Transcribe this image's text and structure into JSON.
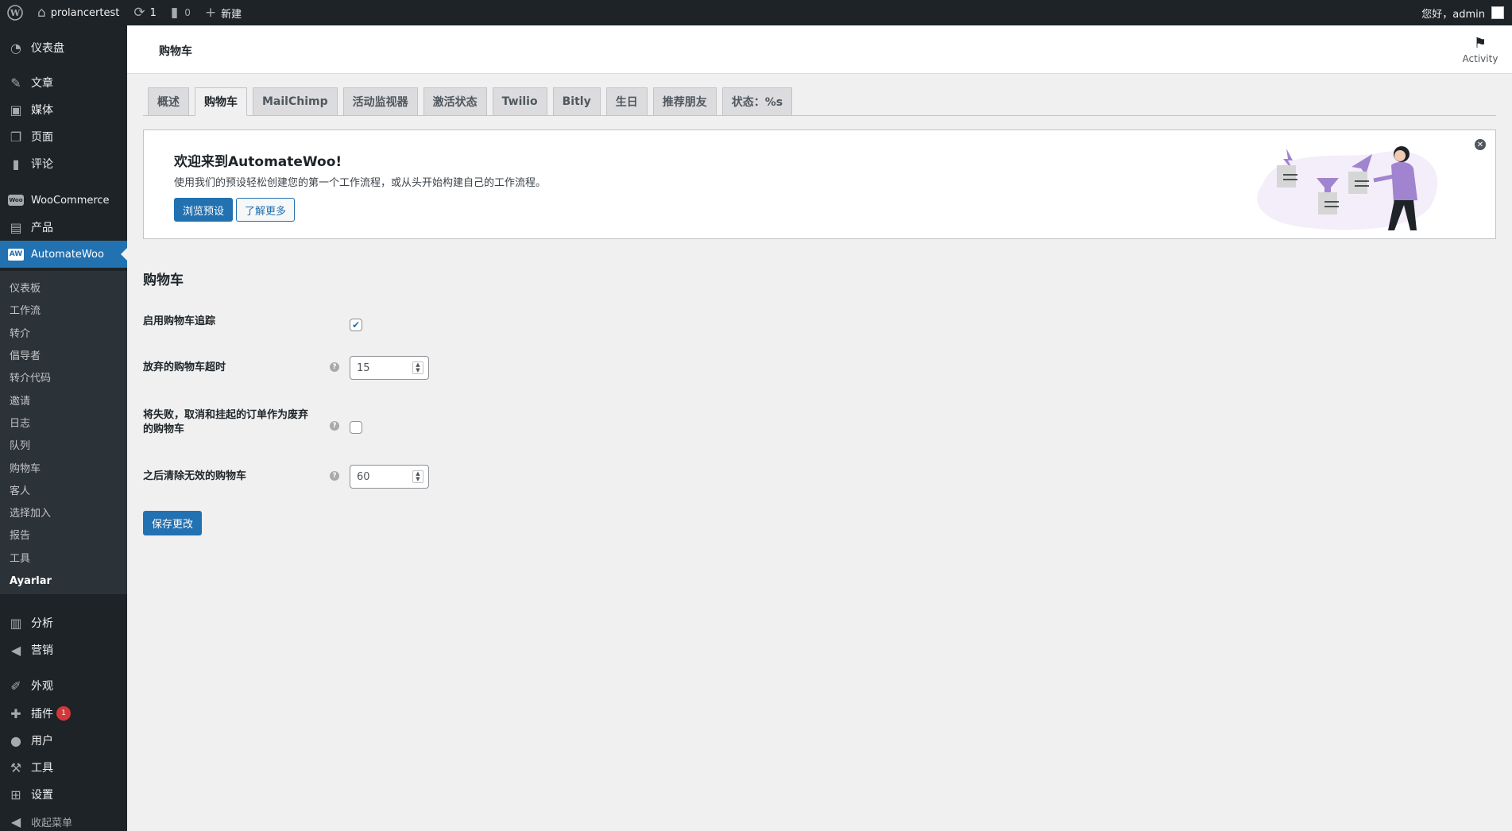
{
  "adminbar": {
    "site_name": "prolancertest",
    "updates_count": "1",
    "comments_count": "0",
    "new_label": "新建",
    "greeting": "您好，admin"
  },
  "sidebar": {
    "dashboard": "仪表盘",
    "posts": "文章",
    "media": "媒体",
    "pages": "页面",
    "comments": "评论",
    "woocommerce": "WooCommerce",
    "products": "产品",
    "automatewoo": "AutomateWoo",
    "aw_logo_text": "AW",
    "woo_logo_text": "Woo",
    "submenu": [
      "仪表板",
      "工作流",
      "转介",
      "倡导者",
      "转介代码",
      "邀请",
      "日志",
      "队列",
      "购物车",
      "客人",
      "选择加入",
      "报告",
      "工具",
      "Ayarlar"
    ],
    "analytics": "分析",
    "marketing": "营销",
    "appearance": "外观",
    "plugins": "插件",
    "plugins_badge": "1",
    "users": "用户",
    "tools": "工具",
    "settings": "设置",
    "collapse": "收起菜单"
  },
  "header": {
    "title": "购物车",
    "activity_label": "Activity"
  },
  "tabs": [
    "概述",
    "购物车",
    "MailChimp",
    "活动监视器",
    "激活状态",
    "Twilio",
    "Bitly",
    "生日",
    "推荐朋友",
    "状态：%s"
  ],
  "active_tab": "购物车",
  "welcome": {
    "title": "欢迎来到AutomateWoo!",
    "description": "使用我们的预设轻松创建您的第一个工作流程，或从头开始构建自己的工作流程。",
    "browse_button": "浏览预设",
    "learn_button": "了解更多"
  },
  "settings": {
    "section_title": "购物车",
    "enable_tracking_label": "启用购物车追踪",
    "enable_tracking_checked": true,
    "abandoned_timeout_label": "放弃的购物车超时",
    "abandoned_timeout_value": "15",
    "failed_orders_label": "将失败，取消和挂起的订单作为废弃的购物车",
    "failed_orders_checked": false,
    "clear_inactive_label": "之后清除无效的购物车",
    "clear_inactive_value": "60",
    "save_button": "保存更改"
  },
  "colors": {
    "accent": "#2271b1",
    "sidebar_bg": "#1d2327",
    "illustration_purple": "#a084cf"
  }
}
